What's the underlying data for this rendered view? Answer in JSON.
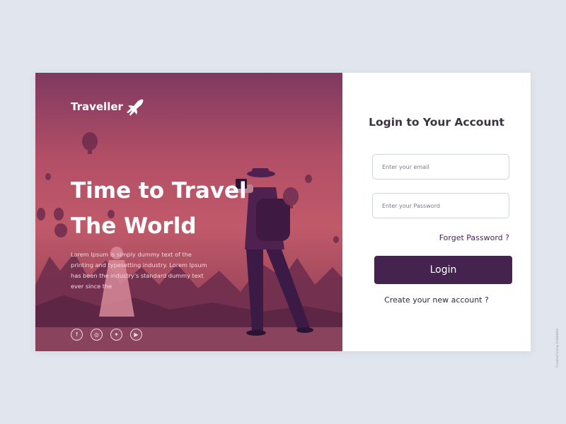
{
  "brand": {
    "name": "Traveller",
    "logo_icon": "airplane-icon"
  },
  "hero": {
    "headline_line1": "Time to Travel",
    "headline_line2": "The World",
    "body": "Lorem Ipsum is simply dummy text of the printing and typesetting industry. Lorem Ipsum has been the industry's standard dummy text ever since the",
    "socials": [
      {
        "name": "facebook",
        "glyph": "f"
      },
      {
        "name": "instagram",
        "glyph": "◎"
      },
      {
        "name": "twitter",
        "glyph": "✦"
      },
      {
        "name": "youtube",
        "glyph": "▶"
      }
    ]
  },
  "login": {
    "title": "Login to Your Account",
    "email_placeholder": "Enter your email",
    "password_placeholder": "Enter your Password",
    "forgot_label": "Forget Password ?",
    "login_label": "Login",
    "create_label": "Create your new account ?"
  },
  "footer": {
    "credit": "Created Using Dribbbble"
  },
  "colors": {
    "primary": "#45234f",
    "hero_tint": "#b24e66",
    "background": "#e1e5ee"
  }
}
